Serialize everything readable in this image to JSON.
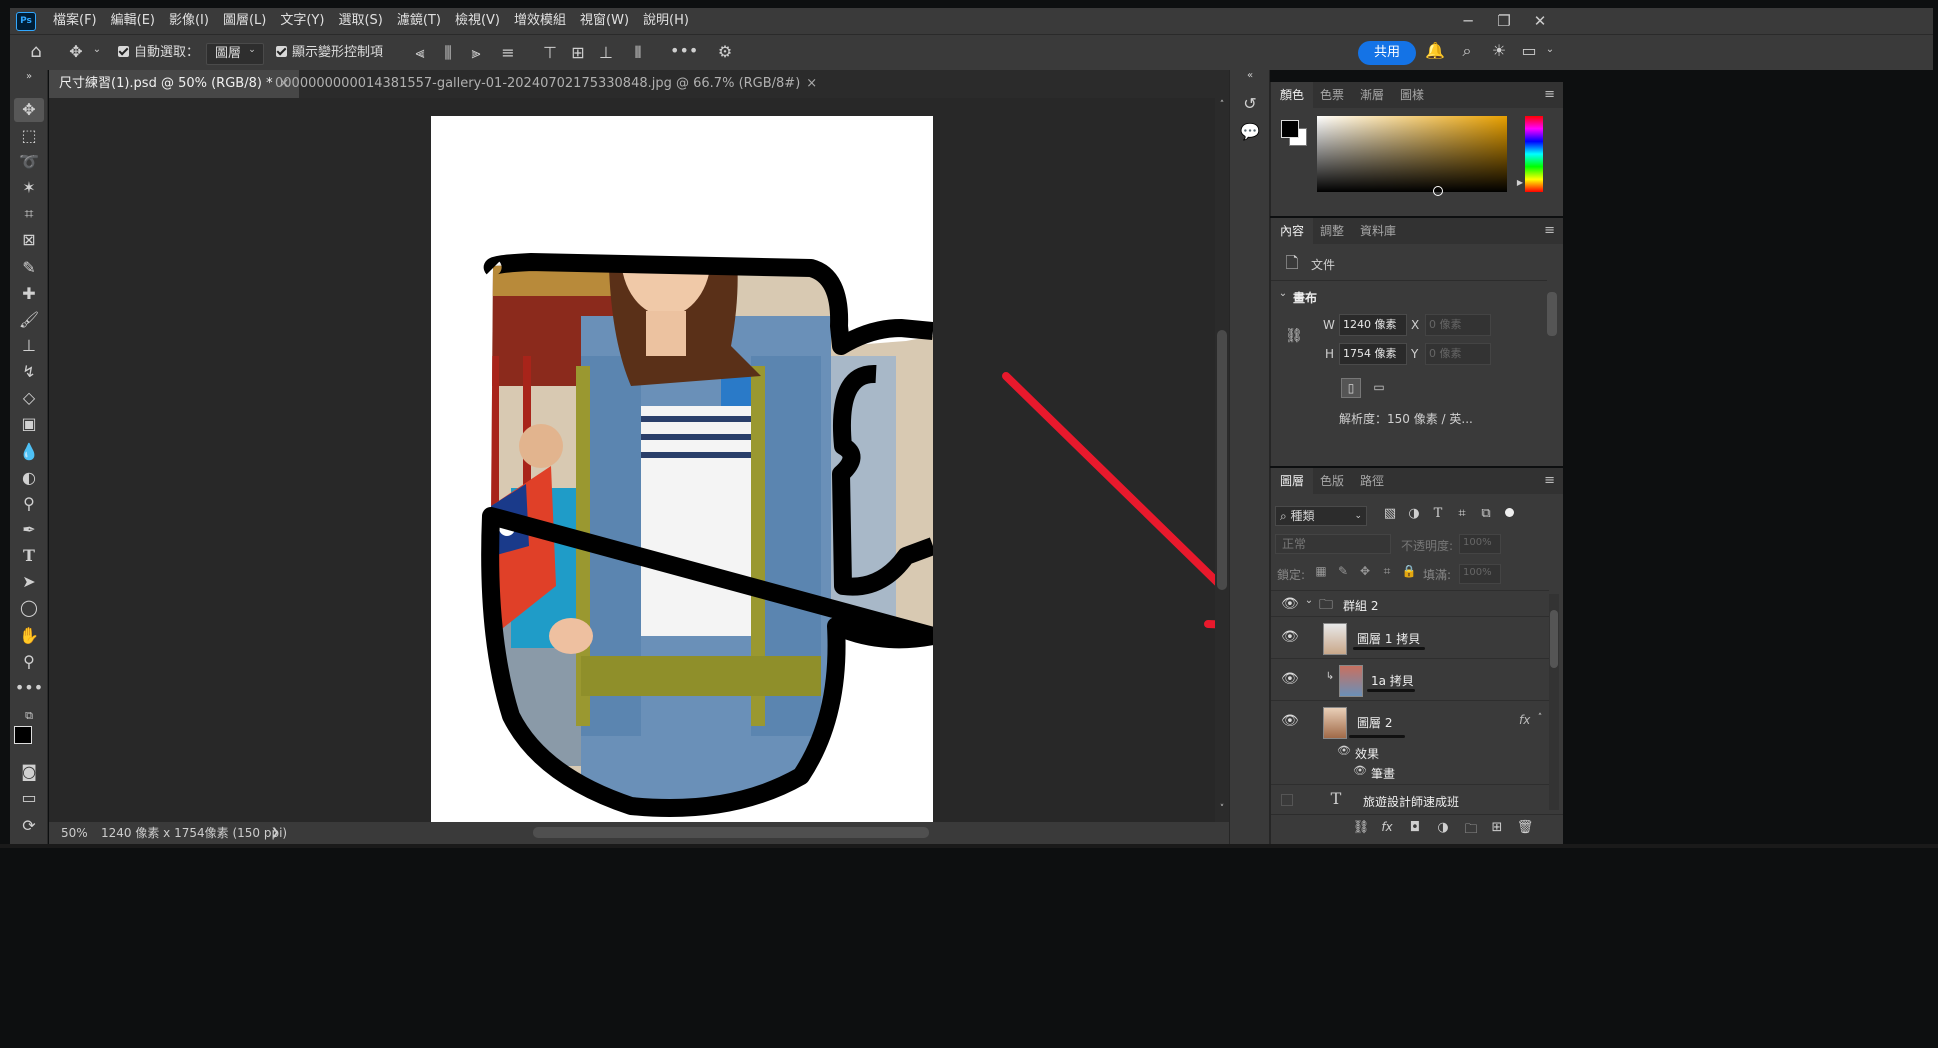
{
  "app": {
    "logo": "Ps"
  },
  "menubar": {
    "items": [
      "檔案(F)",
      "編輯(E)",
      "影像(I)",
      "圖層(L)",
      "文字(Y)",
      "選取(S)",
      "濾鏡(T)",
      "檢視(V)",
      "增效模組",
      "視窗(W)",
      "說明(H)"
    ],
    "window_controls": {
      "minimize": "─",
      "restore": "❐",
      "close": "✕"
    }
  },
  "options_bar": {
    "auto_select_label": "自動選取：",
    "auto_select_checked": true,
    "auto_select_target": "圖層",
    "show_transform_label": "顯示變形控制項",
    "show_transform_checked": true,
    "more": "•••",
    "share_label": "共用"
  },
  "tabs": [
    {
      "label": "尺寸練習(1).psd @ 50% (RGB/8) *",
      "close": "×",
      "active": true
    },
    {
      "label": "0000000000014381557-gallery-01-20240702175330848.jpg @ 66.7% (RGB/8#)",
      "close": "×",
      "active": false
    }
  ],
  "status_bar": {
    "zoom": "50%",
    "doc_info": "1240 像素 x 1754像素 (150 ppi)",
    "arrow": "❯"
  },
  "color_panel": {
    "tabs": [
      "顏色",
      "色票",
      "漸層",
      "圖樣"
    ],
    "active_tab": 0,
    "foreground": "#000000",
    "background": "#ffffff",
    "hue_base": "#e8a000"
  },
  "properties_panel": {
    "tabs": [
      "內容",
      "調整",
      "資料庫"
    ],
    "active_tab": 0,
    "doc_type_label": "文件",
    "section_title": "畫布",
    "w_label": "W",
    "w_value": "1240 像素",
    "h_label": "H",
    "h_value": "1754 像素",
    "x_label": "X",
    "x_value": "0 像素",
    "y_label": "Y",
    "y_value": "0 像素",
    "resolution": "解析度：150 像素 / 英..."
  },
  "layers_panel": {
    "tabs": [
      "圖層",
      "色版",
      "路徑"
    ],
    "active_tab": 0,
    "filter_label": "種類",
    "blend_mode": "正常",
    "opacity_label": "不透明度:",
    "opacity_value": "100%",
    "lock_label": "鎖定:",
    "fill_label": "填滿:",
    "fill_value": "100%",
    "layers": [
      {
        "name": "群組 2",
        "type": "group",
        "visible": true
      },
      {
        "name": "圖層 1 拷貝",
        "type": "pixel",
        "visible": true
      },
      {
        "name": "1a 拷貝",
        "type": "pixel",
        "visible": true,
        "clipped": true
      },
      {
        "name": "圖層 2",
        "type": "pixel",
        "visible": true,
        "fx": "fx"
      },
      {
        "name": "效果",
        "type": "effect",
        "visible": true
      },
      {
        "name": "筆畫",
        "type": "effect",
        "visible": true
      },
      {
        "name": "旅遊設計師速成班",
        "type": "text",
        "visible": false
      }
    ]
  },
  "annotation": {
    "color": "#e8192c"
  }
}
